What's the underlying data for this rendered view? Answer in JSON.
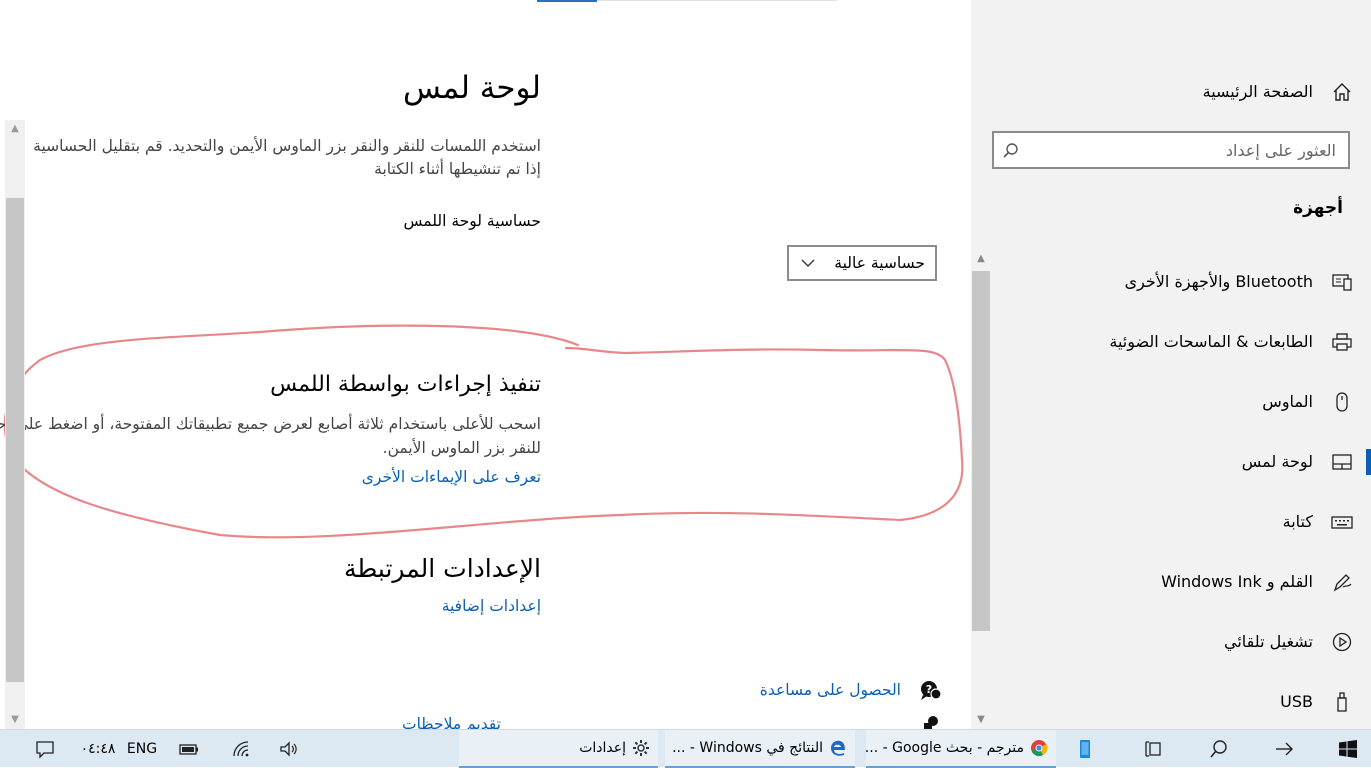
{
  "main": {
    "title": "لوحة لمس",
    "description_line1": "استخدم اللمسات للنقر والنقر بزر الماوس الأيمن والتحديد. قم بتقليل الحساسية",
    "description_line2": "إذا تم تنشيطها أثناء الكتابة",
    "sensitivity_label": "حساسية لوحة اللمس",
    "sensitivity_value": "حساسية عالية",
    "touch_heading": "تنفيذ إجراءات بواسطة اللمس",
    "touch_desc_line1": "اسحب للأعلى باستخدام ثلاثة أصابع لعرض جميع تطبيقاتك المفتوحة، أو اضغط على أحد التطبيقات مرة واحدة باستخدام إصبعين",
    "touch_desc_line2": "للنقر بزر الماوس الأيمن.",
    "gestures_link": "تعرف على الإيماءات الأخرى",
    "related_heading": "الإعدادات المرتبطة",
    "extra_settings_link": "إعدادات إضافية",
    "help_link": "الحصول على مساعدة",
    "feedback_link": "تقديم ملاحظات"
  },
  "sidebar": {
    "home_label": "الصفحة الرئيسية",
    "search_placeholder": "العثور على إعداد",
    "section_heading": "أجهزة",
    "items": [
      {
        "label": "Bluetooth والأجهزة الأخرى",
        "icon": "bluetooth-devices-icon"
      },
      {
        "label": "الطابعات & الماسحات الضوئية",
        "icon": "printer-icon"
      },
      {
        "label": "الماوس",
        "icon": "mouse-icon"
      },
      {
        "label": "لوحة لمس",
        "icon": "touchpad-icon",
        "selected": true
      },
      {
        "label": "كتابة",
        "icon": "keyboard-icon"
      },
      {
        "label": "القلم و Windows Ink",
        "icon": "pen-icon"
      },
      {
        "label": "تشغيل تلقائي",
        "icon": "autoplay-icon"
      },
      {
        "label": "USB",
        "icon": "usb-icon"
      }
    ]
  },
  "taskbar": {
    "apps": [
      {
        "label": "مترجم - بحث Google - ...",
        "icon": "chrome-icon"
      },
      {
        "label": "النتائج في Windows - ...",
        "icon": "edge-icon"
      },
      {
        "label": "إعدادات",
        "icon": "gear-icon"
      }
    ],
    "language": "ENG",
    "time": "٠٤:٤٨"
  },
  "colors": {
    "accent": "#0a5fb4",
    "annotation": "#e8878a",
    "sidebar_bg": "#f2f2f2",
    "taskbar_bg": "#dce8f2"
  }
}
